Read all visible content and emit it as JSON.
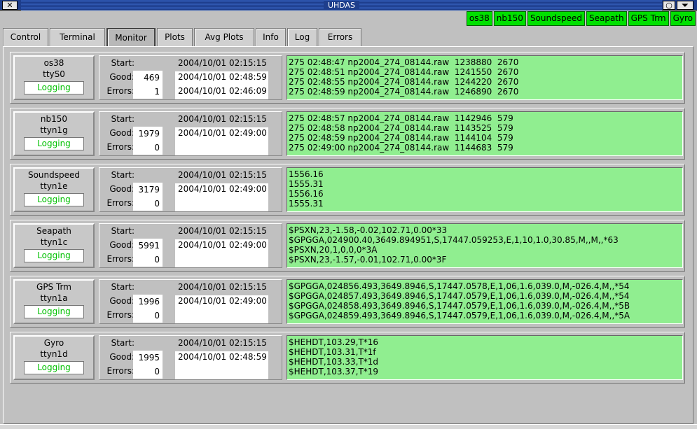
{
  "window": {
    "title": "UHDAS",
    "close_glyph": "✕",
    "min_glyph": "○",
    "menu_glyph": "⏷"
  },
  "status_chips": [
    "os38",
    "nb150",
    "Soundspeed",
    "Seapath",
    "GPS Trm",
    "Gyro"
  ],
  "colors": {
    "ok": "#00e000",
    "raw_bg": "#90ee90",
    "logging_text": "#00c000"
  },
  "tabs": [
    "Control",
    "Terminal",
    "Monitor",
    "Plots",
    "Avg Plots",
    "Info",
    "Log",
    "Errors"
  ],
  "active_tab": "Monitor",
  "labels": {
    "start": "Start:",
    "good": "Good:",
    "errors": "Errors:"
  },
  "instruments": [
    {
      "name": "os38",
      "port": "ttyS0",
      "status": "Logging",
      "start": "2004/10/01 02:15:15",
      "good": "469",
      "good_time": "2004/10/01 02:48:59",
      "errors": "1",
      "error_time": "2004/10/01 02:46:09",
      "raw": [
        "275 02:48:47 np2004_274_08144.raw  1238880  2670",
        "275 02:48:51 np2004_274_08144.raw  1241550  2670",
        "275 02:48:55 np2004_274_08144.raw  1244220  2670",
        "275 02:48:59 np2004_274_08144.raw  1246890  2670"
      ]
    },
    {
      "name": "nb150",
      "port": "ttyn1g",
      "status": "Logging",
      "start": "2004/10/01 02:15:15",
      "good": "1979",
      "good_time": "2004/10/01 02:49:00",
      "errors": "0",
      "error_time": "",
      "raw": [
        "275 02:48:57 np2004_274_08144.raw  1142946  579",
        "275 02:48:58 np2004_274_08144.raw  1143525  579",
        "275 02:48:59 np2004_274_08144.raw  1144104  579",
        "275 02:49:00 np2004_274_08144.raw  1144683  579"
      ]
    },
    {
      "name": "Soundspeed",
      "port": "ttyn1e",
      "status": "Logging",
      "start": "2004/10/01 02:15:15",
      "good": "3179",
      "good_time": "2004/10/01 02:49:00",
      "errors": "0",
      "error_time": "",
      "raw": [
        "1556.16",
        "1555.31",
        "1556.16",
        "1555.31"
      ]
    },
    {
      "name": "Seapath",
      "port": "ttyn1c",
      "status": "Logging",
      "start": "2004/10/01 02:15:15",
      "good": "5991",
      "good_time": "2004/10/01 02:49:00",
      "errors": "0",
      "error_time": "",
      "raw": [
        "$PSXN,23,-1.58,-0.02,102.71,0.00*33",
        "$GPGGA,024900.40,3649.894951,S,17447.059253,E,1,10,1.0,30.85,M,,M,,*63",
        "$PSXN,20,1,0,0,0*3A",
        "$PSXN,23,-1.57,-0.01,102.71,0.00*3F"
      ]
    },
    {
      "name": "GPS Trm",
      "port": "ttyn1a",
      "status": "Logging",
      "start": "2004/10/01 02:15:15",
      "good": "1996",
      "good_time": "2004/10/01 02:49:00",
      "errors": "0",
      "error_time": "",
      "raw": [
        "$GPGGA,024856.493,3649.8946,S,17447.0578,E,1,06,1.6,039.0,M,-026.4,M,,*54",
        "$GPGGA,024857.493,3649.8946,S,17447.0579,E,1,06,1.6,039.0,M,-026.4,M,,*54",
        "$GPGGA,024858.493,3649.8946,S,17447.0579,E,1,06,1.6,039.0,M,-026.4,M,,*5B",
        "$GPGGA,024859.493,3649.8946,S,17447.0579,E,1,06,1.6,039.0,M,-026.4,M,,*5A"
      ]
    },
    {
      "name": "Gyro",
      "port": "ttyn1d",
      "status": "Logging",
      "start": "2004/10/01 02:15:15",
      "good": "1995",
      "good_time": "2004/10/01 02:48:59",
      "errors": "0",
      "error_time": "",
      "raw": [
        "$HEHDT,103.29,T*16",
        "$HEHDT,103.31,T*1f",
        "$HEHDT,103.33,T*1d",
        "$HEHDT,103.37,T*19"
      ]
    }
  ]
}
